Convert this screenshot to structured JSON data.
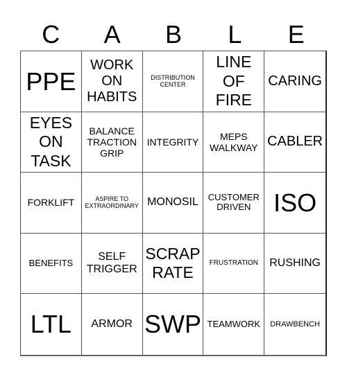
{
  "title_letters": [
    "C",
    "A",
    "B",
    "L",
    "E"
  ],
  "board": [
    [
      {
        "text": "PPE",
        "size": "s-xl"
      },
      {
        "text": "WORK\nON\nHABITS",
        "size": "s-l"
      },
      {
        "text": "DISTRIBUTION\nCENTER",
        "size": "s-tt"
      },
      {
        "text": "LINE\nOF\nFIRE",
        "size": "s-l2"
      },
      {
        "text": "CARING",
        "size": "s-l"
      }
    ],
    [
      {
        "text": "EYES\nON\nTASK",
        "size": "s-l2"
      },
      {
        "text": "BALANCE\nTRACTION\nGRIP",
        "size": "s-s"
      },
      {
        "text": "INTEGRITY",
        "size": "s-s"
      },
      {
        "text": "MEPS\nWALKWAY",
        "size": "s-s"
      },
      {
        "text": "CABLER",
        "size": "s-l"
      }
    ],
    [
      {
        "text": "FORKLIFT",
        "size": "s-s"
      },
      {
        "text": "ASPIRE TO\nEXTRAORDINARY",
        "size": "s-tt"
      },
      {
        "text": "MONOSIL",
        "size": "s-m"
      },
      {
        "text": "CUSTOMER\nDRIVEN",
        "size": "s-xs"
      },
      {
        "text": "ISO",
        "size": "s-xl"
      }
    ],
    [
      {
        "text": "BENEFITS",
        "size": "s-xs"
      },
      {
        "text": "SELF\nTRIGGER",
        "size": "s-m"
      },
      {
        "text": "SCRAP\nRATE",
        "size": "s-l2"
      },
      {
        "text": "FRUSTRATION",
        "size": "s-t"
      },
      {
        "text": "RUSHING",
        "size": "s-m"
      }
    ],
    [
      {
        "text": "LTL",
        "size": "s-xl"
      },
      {
        "text": "ARMOR",
        "size": "s-m"
      },
      {
        "text": "SWP",
        "size": "s-xl"
      },
      {
        "text": "TEAMWORK",
        "size": "s-xs"
      },
      {
        "text": "DRAWBENCH",
        "size": "s-xxs"
      }
    ]
  ]
}
